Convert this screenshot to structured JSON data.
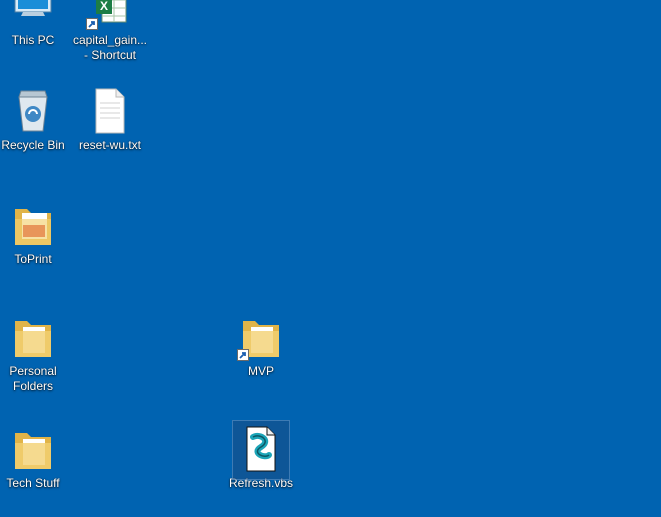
{
  "desktop": {
    "background_color": "#0063b1",
    "icons": [
      {
        "id": "this-pc",
        "label": "This PC",
        "icon": "monitor-icon"
      },
      {
        "id": "capital-gains",
        "label": "capital_gain...\n- Shortcut",
        "icon": "excel-icon",
        "shortcut": true
      },
      {
        "id": "recycle-bin",
        "label": "Recycle Bin",
        "icon": "recycle-bin-icon"
      },
      {
        "id": "reset-wu",
        "label": "reset-wu.txt",
        "icon": "text-file-icon"
      },
      {
        "id": "toprint",
        "label": "ToPrint",
        "icon": "folder-pdf-icon"
      },
      {
        "id": "personal-folders",
        "label": "Personal\nFolders",
        "icon": "folder-icon"
      },
      {
        "id": "mvp",
        "label": "MVP",
        "icon": "folder-icon",
        "shortcut": true
      },
      {
        "id": "tech-stuff",
        "label": "Tech Stuff",
        "icon": "folder-icon"
      },
      {
        "id": "refresh-vbs",
        "label": "Refresh.vbs",
        "icon": "vbscript-file-icon",
        "selected": true
      }
    ]
  }
}
